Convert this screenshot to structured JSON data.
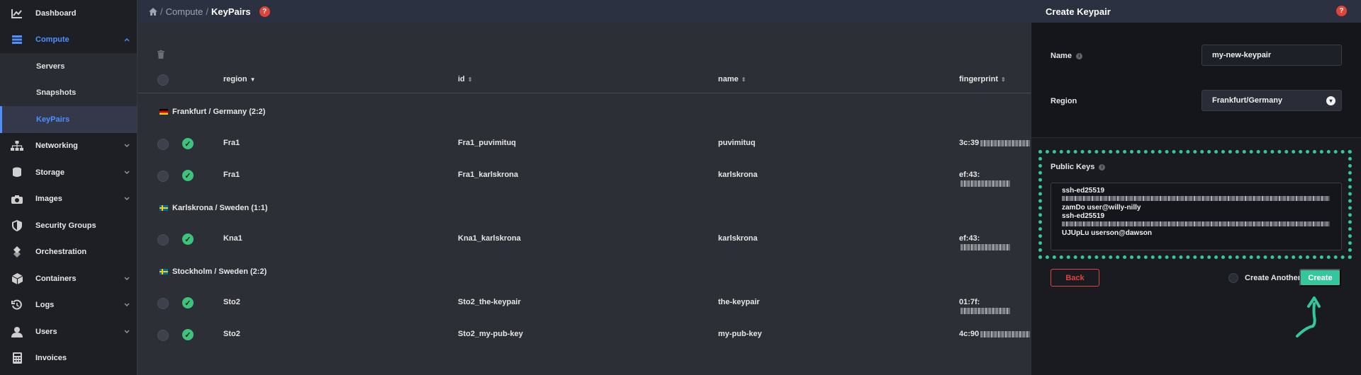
{
  "sidebar": {
    "items": [
      {
        "label": "Dashboard",
        "icon": "chart-icon",
        "expandable": false
      },
      {
        "label": "Compute",
        "icon": "server-stack-icon",
        "expandable": true,
        "expanded": true
      },
      {
        "label": "Networking",
        "icon": "network-icon",
        "expandable": true
      },
      {
        "label": "Storage",
        "icon": "database-icon",
        "expandable": true
      },
      {
        "label": "Images",
        "icon": "camera-icon",
        "expandable": true
      },
      {
        "label": "Security Groups",
        "icon": "shield-icon",
        "expandable": false
      },
      {
        "label": "Orchestration",
        "icon": "orchestration-icon",
        "expandable": false
      },
      {
        "label": "Containers",
        "icon": "cube-icon",
        "expandable": true
      },
      {
        "label": "Logs",
        "icon": "history-icon",
        "expandable": true
      },
      {
        "label": "Users",
        "icon": "user-icon",
        "expandable": true
      },
      {
        "label": "Invoices",
        "icon": "calculator-icon",
        "expandable": false
      }
    ],
    "compute_children": [
      "Servers",
      "Snapshots",
      "KeyPairs"
    ]
  },
  "breadcrumb": {
    "home_icon": "home-icon",
    "parent": "Compute",
    "current": "KeyPairs",
    "sep": "/"
  },
  "help": "?",
  "table": {
    "columns": {
      "region": "region",
      "id": "id",
      "name": "name",
      "fingerprint": "fingerprint"
    },
    "groups": [
      {
        "label": "Frankfurt / Germany (2:2)",
        "flag": "de"
      },
      {
        "label": "Karlskrona / Sweden (1:1)",
        "flag": "se"
      },
      {
        "label": "Stockholm / Sweden (2:2)",
        "flag": "se"
      }
    ],
    "rows": [
      {
        "region": "Fra1",
        "id": "Fra1_puvimituq",
        "name": "puvimituq",
        "fingerprint": "3c:39"
      },
      {
        "region": "Fra1",
        "id": "Fra1_karlskrona",
        "name": "karlskrona",
        "fingerprint": "ef:43:"
      },
      {
        "region": "Kna1",
        "id": "Kna1_karlskrona",
        "name": "karlskrona",
        "fingerprint": "ef:43:"
      },
      {
        "region": "Sto2",
        "id": "Sto2_the-keypair",
        "name": "the-keypair",
        "fingerprint": "01:7f:"
      },
      {
        "region": "Sto2",
        "id": "Sto2_my-pub-key",
        "name": "my-pub-key",
        "fingerprint": "4c:90"
      }
    ]
  },
  "panel": {
    "title": "Create Keypair",
    "name_label": "Name",
    "name_value": "my-new-keypair",
    "region_label": "Region",
    "region_value": "Frankfurt/Germany",
    "public_keys_label": "Public Keys",
    "key_lines": {
      "l1": "ssh-ed25519",
      "l2": "zamDo user@willy-nilly",
      "l3": "ssh-ed25519",
      "l4": "UJUpLu userson@dawson"
    },
    "back_label": "Back",
    "create_another_label": "Create Another",
    "create_label": "Create"
  },
  "colors": {
    "accent": "#4d90fe",
    "success": "#3cc37c",
    "create": "#34c69c",
    "danger": "#e0433a"
  }
}
